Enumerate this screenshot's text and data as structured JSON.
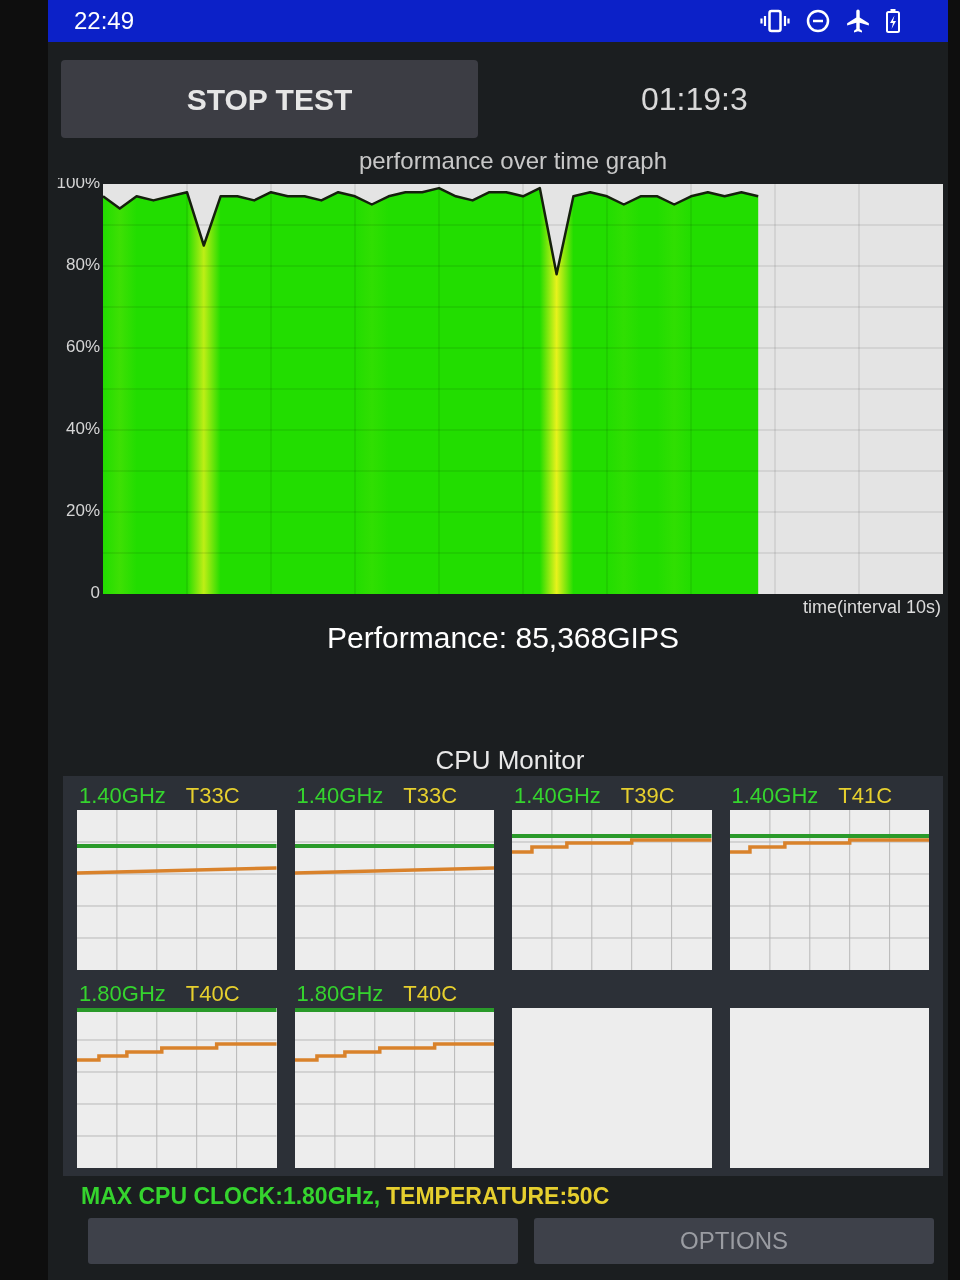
{
  "status_bar": {
    "time": "22:49"
  },
  "header": {
    "stop_button": "STOP TEST",
    "timer": "01:19:3"
  },
  "performance_graph": {
    "chart_data": {
      "type": "area",
      "title": "performance over time graph",
      "xlabel": "time(interval 10s)",
      "categories": [
        null,
        null,
        null,
        null,
        null,
        null,
        null,
        null,
        null,
        null,
        null,
        null,
        null,
        null,
        null,
        null,
        null,
        null,
        null,
        null,
        null,
        null,
        null,
        null,
        null,
        null,
        null,
        null,
        null,
        null,
        null,
        null,
        null,
        null,
        null,
        null,
        null,
        null,
        null,
        null,
        null,
        null,
        null,
        null,
        null,
        null,
        null,
        null,
        null,
        null
      ],
      "series": [
        {
          "color": "#22dd00",
          "values": [
            97,
            94,
            97,
            96,
            97,
            98,
            85,
            97,
            97,
            96,
            98,
            97,
            97,
            96,
            98,
            97,
            95,
            97,
            98,
            98,
            99,
            97,
            96,
            98,
            98,
            97,
            99,
            78,
            97,
            98,
            97,
            95,
            97,
            97,
            95,
            97,
            98,
            97,
            98,
            97,
            null,
            null,
            null,
            null,
            null,
            null,
            null,
            null,
            null,
            null
          ]
        }
      ],
      "ylim": [
        0,
        100
      ],
      "yticks": [
        {
          "value": 0,
          "label": "0"
        },
        {
          "value": 20,
          "label": "20%"
        },
        {
          "value": 40,
          "label": "40%"
        },
        {
          "value": 60,
          "label": "60%"
        },
        {
          "value": 80,
          "label": "80%"
        },
        {
          "value": 100,
          "label": "100%"
        }
      ],
      "grid": true
    }
  },
  "performance": "Performance: 85,368GIPS",
  "cpu_monitor": {
    "title": "CPU Monitor",
    "cores": [
      {
        "kind": "steady",
        "frequency": "1.40GHz",
        "temperature": "T33C"
      },
      {
        "kind": "steady",
        "frequency": "1.40GHz",
        "temperature": "T33C"
      },
      {
        "kind": "rising",
        "frequency": "1.40GHz",
        "temperature": "T39C"
      },
      {
        "kind": "rising",
        "frequency": "1.40GHz",
        "temperature": "T41C"
      },
      {
        "kind": "max",
        "frequency": "1.80GHz",
        "temperature": "T40C"
      },
      {
        "kind": "max",
        "frequency": "1.80GHz",
        "temperature": "T40C"
      },
      {
        "kind": "offline"
      },
      {
        "kind": "offline"
      }
    ],
    "max_clock": "MAX CPU CLOCK:1.80GHz,",
    "max_temperature": "TEMPERATURE:50C"
  },
  "bottom_buttons": [
    {
      "kind": "blank"
    },
    {
      "kind": "labeled",
      "label": "OPTIONS"
    }
  ]
}
